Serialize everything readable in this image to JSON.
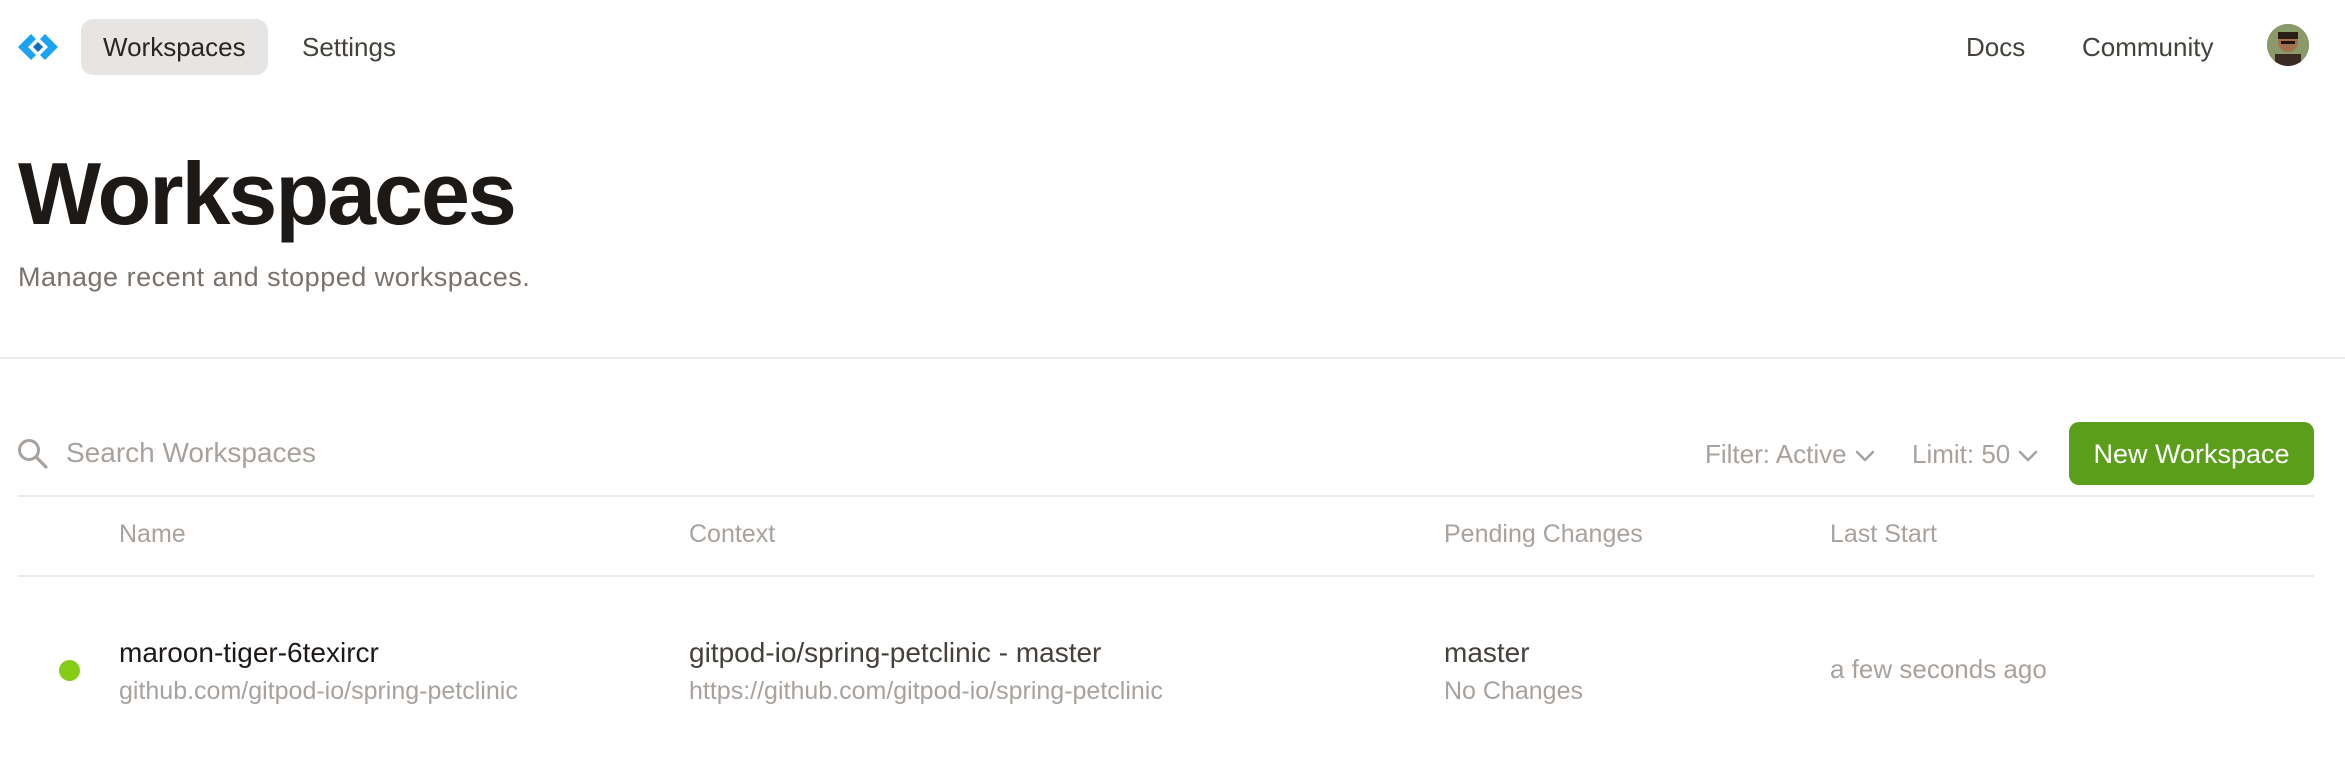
{
  "nav": {
    "items": [
      {
        "label": "Workspaces",
        "active": true
      },
      {
        "label": "Settings",
        "active": false
      }
    ],
    "right_items": [
      {
        "label": "Docs"
      },
      {
        "label": "Community"
      }
    ]
  },
  "header": {
    "title": "Workspaces",
    "subtitle": "Manage recent and stopped workspaces."
  },
  "toolbar": {
    "search_placeholder": "Search Workspaces",
    "filter_label": "Filter: Active",
    "limit_label": "Limit: 50",
    "new_workspace_label": "New Workspace"
  },
  "table": {
    "columns": [
      "Name",
      "Context",
      "Pending Changes",
      "Last Start"
    ],
    "rows": [
      {
        "status": "running",
        "name": "maroon-tiger-6texircr",
        "repo": "github.com/gitpod-io/spring-petclinic",
        "context_title": "gitpod-io/spring-petclinic - master",
        "context_url": "https://github.com/gitpod-io/spring-petclinic",
        "branch": "master",
        "changes": "No Changes",
        "last_start": "a few seconds ago"
      }
    ]
  },
  "colors": {
    "brand_blue": "#1aa3f0",
    "accent_green": "#5b9e1a",
    "status_running": "#84cc16"
  },
  "icons": [
    "gitpod-logo-icon",
    "search-icon",
    "chevron-down-icon",
    "avatar"
  ]
}
